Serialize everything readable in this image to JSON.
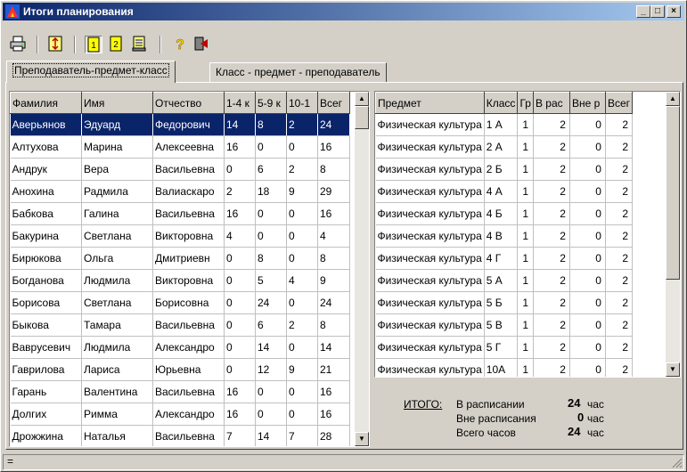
{
  "window": {
    "title": "Итоги планирования",
    "minimize": "_",
    "maximize": "□",
    "close": "×"
  },
  "toolbar": {
    "icons": [
      "printer-icon",
      "swap-icon",
      "view1-icon",
      "view2-icon",
      "report-icon",
      "help-icon",
      "exit-icon"
    ]
  },
  "tabs": [
    "Преподаватель-предмет-класс",
    "Класс - предмет - преподаватель"
  ],
  "teachers": {
    "columns": [
      "Фамилия",
      "Имя",
      "Отчество",
      "1-4 к",
      "5-9 к",
      "10-1",
      "Всег"
    ],
    "rows": [
      [
        "Аверьянов",
        "Эдуард",
        "Федорович",
        "14",
        "8",
        "2",
        "24"
      ],
      [
        "Алтухова",
        "Марина",
        "Алексеевна",
        "16",
        "0",
        "0",
        "16"
      ],
      [
        "Андрук",
        "Вера",
        "Васильевна",
        "0",
        "6",
        "2",
        "8"
      ],
      [
        "Анохина",
        "Радмила",
        "Валиаскаро",
        "2",
        "18",
        "9",
        "29"
      ],
      [
        "Бабкова",
        "Галина",
        "Васильевна",
        "16",
        "0",
        "0",
        "16"
      ],
      [
        "Бакурина",
        "Светлана",
        "Викторовна",
        "4",
        "0",
        "0",
        "4"
      ],
      [
        "Бирюкова",
        "Ольга",
        "Дмитриевн",
        "0",
        "8",
        "0",
        "8"
      ],
      [
        "Богданова",
        "Людмила",
        "Викторовна",
        "0",
        "5",
        "4",
        "9"
      ],
      [
        "Борисова",
        "Светлана",
        "Борисовна",
        "0",
        "24",
        "0",
        "24"
      ],
      [
        "Быкова",
        "Тамара",
        "Васильевна",
        "0",
        "6",
        "2",
        "8"
      ],
      [
        "Вавpусевич",
        "Людмила",
        "Александро",
        "0",
        "14",
        "0",
        "14"
      ],
      [
        "Гаврилова",
        "Лариса",
        "Юрьевна",
        "0",
        "12",
        "9",
        "21"
      ],
      [
        "Гарань",
        "Валентина",
        "Васильевна",
        "16",
        "0",
        "0",
        "16"
      ],
      [
        "Долгих",
        "Римма",
        "Александро",
        "16",
        "0",
        "0",
        "16"
      ],
      [
        "Дрожжина",
        "Наталья",
        "Васильевна",
        "7",
        "14",
        "7",
        "28"
      ]
    ]
  },
  "subjects": {
    "columns": [
      "Предмет",
      "Класс",
      "Гр",
      "В рас",
      "Вне р",
      "Всег"
    ],
    "rows": [
      [
        "Физическая культура",
        "1 А",
        "1",
        "2",
        "0",
        "2"
      ],
      [
        "Физическая культура",
        "2 А",
        "1",
        "2",
        "0",
        "2"
      ],
      [
        "Физическая культура",
        "2 Б",
        "1",
        "2",
        "0",
        "2"
      ],
      [
        "Физическая культура",
        "4 А",
        "1",
        "2",
        "0",
        "2"
      ],
      [
        "Физическая культура",
        "4 Б",
        "1",
        "2",
        "0",
        "2"
      ],
      [
        "Физическая культура",
        "4 В",
        "1",
        "2",
        "0",
        "2"
      ],
      [
        "Физическая культура",
        "4 Г",
        "1",
        "2",
        "0",
        "2"
      ],
      [
        "Физическая культура",
        "5 А",
        "1",
        "2",
        "0",
        "2"
      ],
      [
        "Физическая культура",
        "5 Б",
        "1",
        "2",
        "0",
        "2"
      ],
      [
        "Физическая культура",
        "5 В",
        "1",
        "2",
        "0",
        "2"
      ],
      [
        "Физическая культура",
        "5 Г",
        "1",
        "2",
        "0",
        "2"
      ],
      [
        "Физическая культура",
        "10А",
        "1",
        "2",
        "0",
        "2"
      ]
    ]
  },
  "summary": {
    "title": "ИТОГО:",
    "in_schedule_label": "В расписании",
    "in_schedule_value": "24",
    "out_schedule_label": "Вне расписания",
    "out_schedule_value": "0",
    "total_label": "Всего часов",
    "total_value": "24",
    "unit": "час"
  },
  "statusbar": {
    "text": "="
  },
  "colors": {
    "title_start": "#0a246a",
    "title_end": "#a6caf0",
    "selection": "#0a246a"
  }
}
